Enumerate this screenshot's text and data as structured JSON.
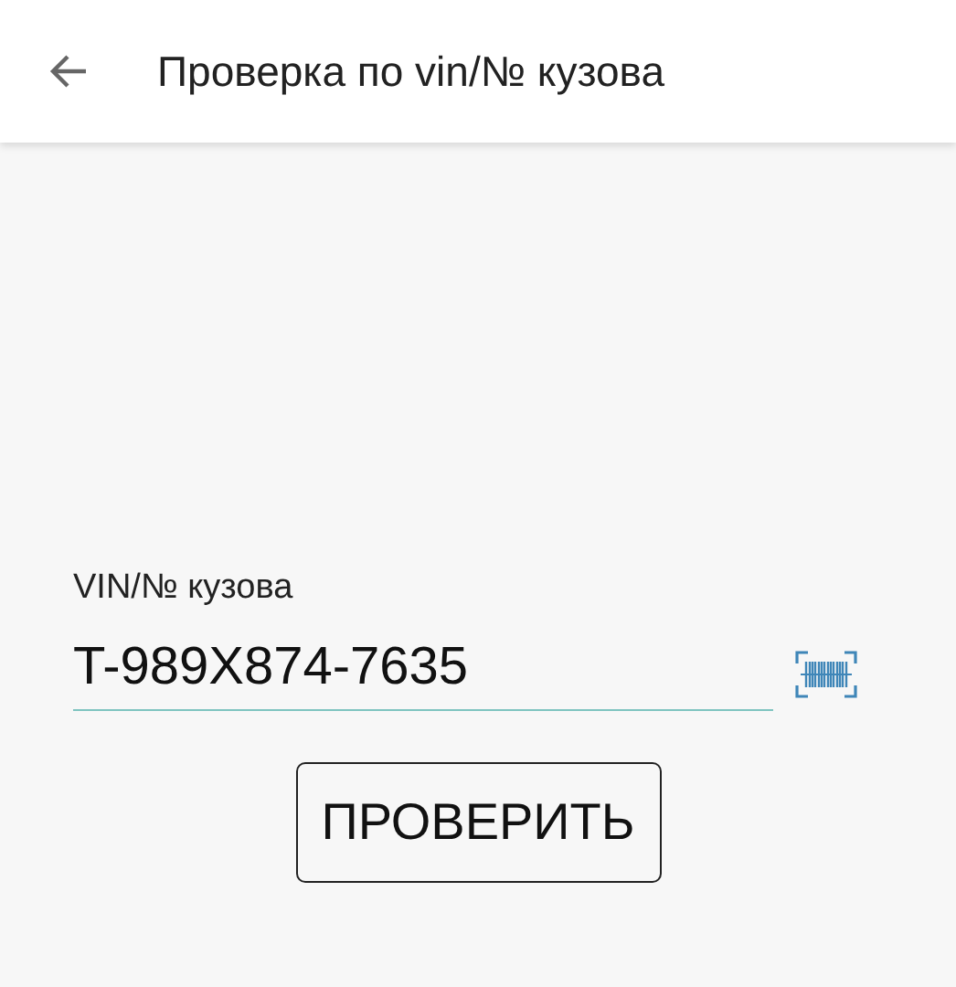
{
  "header": {
    "title": "Проверка по vin/№ кузова"
  },
  "vin_field": {
    "label": "VIN/№ кузова",
    "value": "T-989X874-7635"
  },
  "buttons": [
    {
      "label": "ПРОВЕРИТЬ"
    }
  ]
}
